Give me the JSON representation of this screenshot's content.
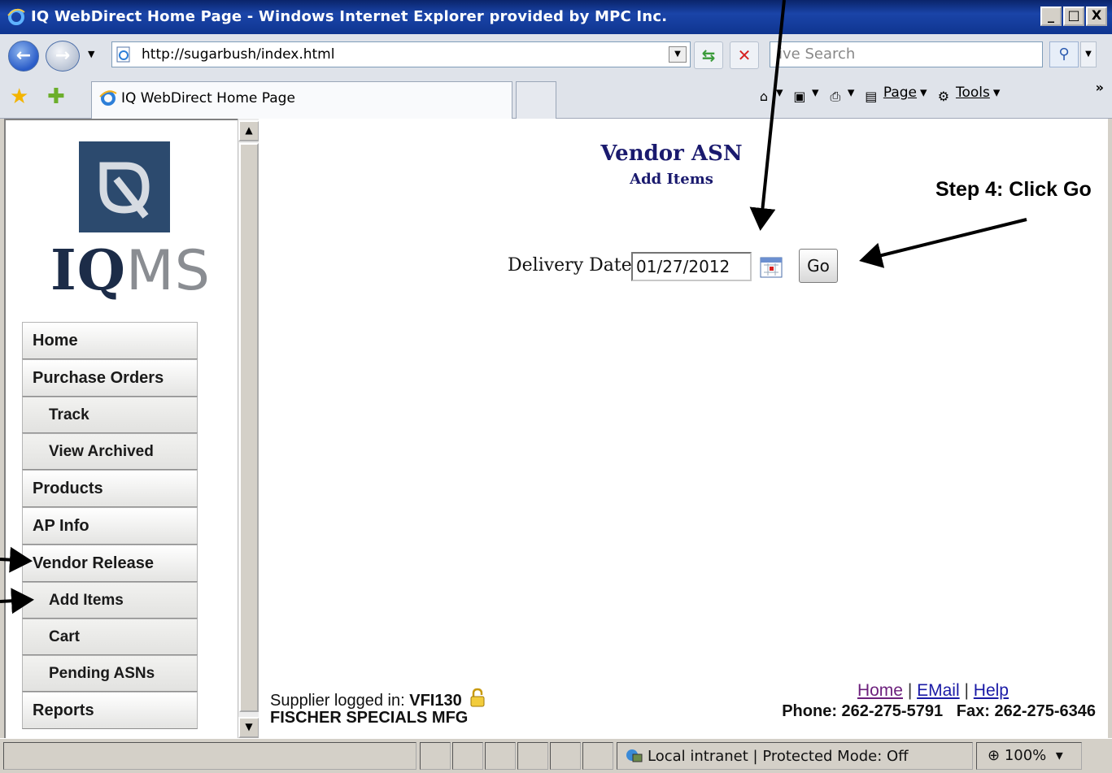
{
  "window": {
    "title": "IQ WebDirect Home Page - Windows Internet Explorer provided by MPC Inc.",
    "buttons": [
      "_",
      "□",
      "X"
    ]
  },
  "address": {
    "url": "http://sugarbush/index.html",
    "search_placeholder": "ive Search"
  },
  "tabs": {
    "active_tab": "IQ WebDirect Home Page"
  },
  "command_bar": {
    "page_label": "Page",
    "tools_label": "Tools",
    "more": "»"
  },
  "logo": {
    "iq": "IQ",
    "ms": "MS"
  },
  "menu": [
    {
      "label": "Home",
      "sub": false
    },
    {
      "label": "Purchase Orders",
      "sub": false
    },
    {
      "label": "Track",
      "sub": true
    },
    {
      "label": "View Archived",
      "sub": true
    },
    {
      "label": "Products",
      "sub": false
    },
    {
      "label": "AP Info",
      "sub": false
    },
    {
      "label": "Vendor Release",
      "sub": false
    },
    {
      "label": "Add Items",
      "sub": true
    },
    {
      "label": "Cart",
      "sub": true
    },
    {
      "label": "Pending ASNs",
      "sub": true
    },
    {
      "label": "Reports",
      "sub": false
    }
  ],
  "main": {
    "heading": "Vendor ASN",
    "subheading": "Add Items",
    "delivery_label": "Delivery Date",
    "delivery_value": "01/27/2012",
    "go_label": "Go"
  },
  "footer": {
    "supplier_prefix": "Supplier logged in:",
    "supplier_id": "VFI130",
    "company": "FISCHER SPECIALS MFG",
    "link_home": "Home",
    "link_email": "EMail",
    "link_help": "Help",
    "separator": "|",
    "phone": "Phone: 262-275-5791",
    "fax": "Fax: 262-275-6346"
  },
  "status": {
    "zone": "Local intranet | Protected Mode: Off",
    "zoom": "100%"
  },
  "annotation": {
    "step4": "Step 4: Click Go"
  },
  "colors": {
    "title_bar": "#0a246a",
    "heading": "#1a1a6e",
    "logo_square": "#2c4a6e"
  }
}
